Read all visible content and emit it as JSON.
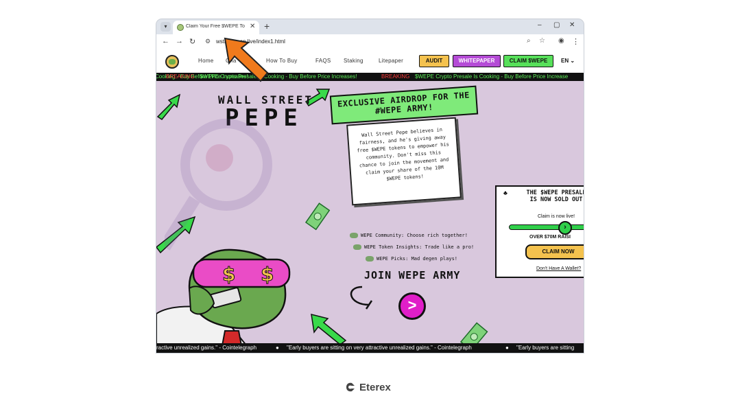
{
  "browser": {
    "tab_title": "Claim Your Free $WEPE Token |",
    "url": "wstreetpeep.live/index1.html",
    "window_controls": [
      "–",
      "▢",
      "✕"
    ]
  },
  "site_nav": {
    "links": [
      "Home",
      "Cha",
      "How To Buy",
      "FAQS",
      "Staking",
      "Litepaper"
    ],
    "audit": "AUDIT",
    "whitepaper": "WHITEPAPER",
    "claim": "CLAIM $WEPE",
    "lang": "EN"
  },
  "ticker": {
    "breaking": "BREAKING",
    "headline": "$WEPE Crypto Presale Is Cooking - Buy Before Price Increases!",
    "headline_cut": "$WEPE Crypto Presale Is Cooking - Buy Before Price Increase",
    "headline_start": "$WEPE Crypto Presa",
    "headline_end": "Cooking - Buy Before Price Increases!"
  },
  "hero": {
    "line1": "WALL STREET",
    "line2": "PEPE"
  },
  "airdrop": {
    "heading_1": "EXCLUSIVE AIRDROP FOR THE",
    "heading_2": "#WEPE ARMY!",
    "body": "Wall Street Pepe believes in fairness, and he's giving away free $WEPE tokens to empower his community. Don't miss this chance to join the movement and claim your share of the 10M $WEPE tokens!"
  },
  "features": [
    "WEPE Community: Choose rich together!",
    "WEPE Token Insights: Trade like a pro!",
    "WEPE Picks: Mad degen plays!"
  ],
  "join": {
    "label": "JOIN WEPE ARMY",
    "button": ">"
  },
  "presale": {
    "title": "THE $WEPE PRESALE IS NOW SOLD OUT",
    "subtitle": "Claim is now live!",
    "raised": "OVER $70M RAISI",
    "claim_button": "CLAIM NOW",
    "no_wallet": "Don't Have A Wallet?"
  },
  "footer_ticker": {
    "quote_a": "ractive unrealized gains.\" - Cointelegraph",
    "quote_b": "\"Early buyers are sitting on very attractive unrealized gains.\" - Cointelegraph",
    "quote_c": "\"Early buyers are sitting"
  },
  "brand": {
    "name": "Eterex"
  },
  "colors": {
    "page_bg": "#d9c8dd",
    "accent_green": "#57e05a",
    "accent_pink": "#e01ec8",
    "annotation_orange": "#f07a1c"
  }
}
